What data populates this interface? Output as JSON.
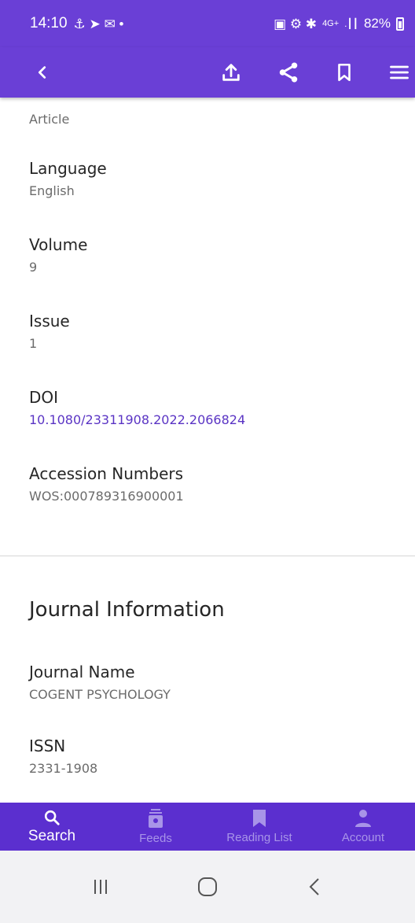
{
  "status_bar": {
    "time": "14:10",
    "left_glyphs": "⚓ ➤ ✉ •",
    "right_glyphs": "▣ ⚙ ✱",
    "network": "4G+",
    "signal": ".┃┃",
    "battery": "82%"
  },
  "app_bar": {
    "actions": [
      "back",
      "upload",
      "share",
      "bookmark",
      "menu"
    ]
  },
  "record": {
    "fields": [
      {
        "label": "Language",
        "value": "English"
      },
      {
        "label": "Volume",
        "value": "9"
      },
      {
        "label": "Issue",
        "value": "1"
      },
      {
        "label": "DOI",
        "value": "10.1080/23311908.2022.2066824"
      },
      {
        "label": "Accession Numbers",
        "value": "WOS:000789316900001"
      }
    ],
    "first_value": "Article"
  },
  "journal": {
    "section_title": "Journal Information",
    "fields": [
      {
        "label": "Journal Name",
        "value": "COGENT PSYCHOLOGY"
      },
      {
        "label": "ISSN",
        "value": "2331-1908"
      }
    ]
  },
  "bottom_nav": {
    "items": [
      {
        "label": "Search",
        "icon": "search-icon"
      },
      {
        "label": "Feeds",
        "icon": "feeds-icon"
      },
      {
        "label": "Reading List",
        "icon": "bookmark-icon"
      },
      {
        "label": "Account",
        "icon": "person-icon"
      }
    ]
  },
  "colors": {
    "primary": "#6a3fd6",
    "nav_bg": "#5b2fcf",
    "link": "#5a34c4"
  }
}
